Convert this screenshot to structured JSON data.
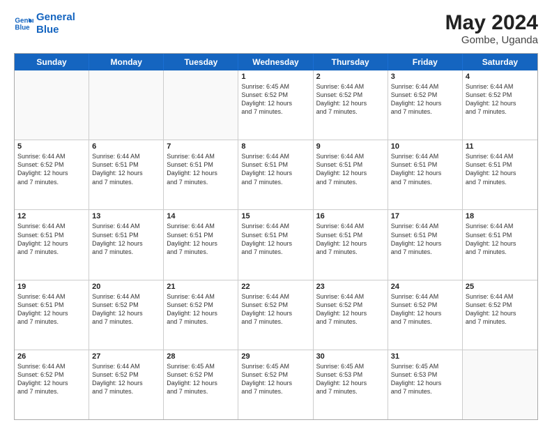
{
  "logo": {
    "line1": "General",
    "line2": "Blue"
  },
  "title": {
    "month_year": "May 2024",
    "location": "Gombe, Uganda"
  },
  "header_days": [
    "Sunday",
    "Monday",
    "Tuesday",
    "Wednesday",
    "Thursday",
    "Friday",
    "Saturday"
  ],
  "weeks": [
    [
      {
        "day": "",
        "info": ""
      },
      {
        "day": "",
        "info": ""
      },
      {
        "day": "",
        "info": ""
      },
      {
        "day": "1",
        "info": "Sunrise: 6:45 AM\nSunset: 6:52 PM\nDaylight: 12 hours\nand 7 minutes."
      },
      {
        "day": "2",
        "info": "Sunrise: 6:44 AM\nSunset: 6:52 PM\nDaylight: 12 hours\nand 7 minutes."
      },
      {
        "day": "3",
        "info": "Sunrise: 6:44 AM\nSunset: 6:52 PM\nDaylight: 12 hours\nand 7 minutes."
      },
      {
        "day": "4",
        "info": "Sunrise: 6:44 AM\nSunset: 6:52 PM\nDaylight: 12 hours\nand 7 minutes."
      }
    ],
    [
      {
        "day": "5",
        "info": "Sunrise: 6:44 AM\nSunset: 6:52 PM\nDaylight: 12 hours\nand 7 minutes."
      },
      {
        "day": "6",
        "info": "Sunrise: 6:44 AM\nSunset: 6:51 PM\nDaylight: 12 hours\nand 7 minutes."
      },
      {
        "day": "7",
        "info": "Sunrise: 6:44 AM\nSunset: 6:51 PM\nDaylight: 12 hours\nand 7 minutes."
      },
      {
        "day": "8",
        "info": "Sunrise: 6:44 AM\nSunset: 6:51 PM\nDaylight: 12 hours\nand 7 minutes."
      },
      {
        "day": "9",
        "info": "Sunrise: 6:44 AM\nSunset: 6:51 PM\nDaylight: 12 hours\nand 7 minutes."
      },
      {
        "day": "10",
        "info": "Sunrise: 6:44 AM\nSunset: 6:51 PM\nDaylight: 12 hours\nand 7 minutes."
      },
      {
        "day": "11",
        "info": "Sunrise: 6:44 AM\nSunset: 6:51 PM\nDaylight: 12 hours\nand 7 minutes."
      }
    ],
    [
      {
        "day": "12",
        "info": "Sunrise: 6:44 AM\nSunset: 6:51 PM\nDaylight: 12 hours\nand 7 minutes."
      },
      {
        "day": "13",
        "info": "Sunrise: 6:44 AM\nSunset: 6:51 PM\nDaylight: 12 hours\nand 7 minutes."
      },
      {
        "day": "14",
        "info": "Sunrise: 6:44 AM\nSunset: 6:51 PM\nDaylight: 12 hours\nand 7 minutes."
      },
      {
        "day": "15",
        "info": "Sunrise: 6:44 AM\nSunset: 6:51 PM\nDaylight: 12 hours\nand 7 minutes."
      },
      {
        "day": "16",
        "info": "Sunrise: 6:44 AM\nSunset: 6:51 PM\nDaylight: 12 hours\nand 7 minutes."
      },
      {
        "day": "17",
        "info": "Sunrise: 6:44 AM\nSunset: 6:51 PM\nDaylight: 12 hours\nand 7 minutes."
      },
      {
        "day": "18",
        "info": "Sunrise: 6:44 AM\nSunset: 6:51 PM\nDaylight: 12 hours\nand 7 minutes."
      }
    ],
    [
      {
        "day": "19",
        "info": "Sunrise: 6:44 AM\nSunset: 6:51 PM\nDaylight: 12 hours\nand 7 minutes."
      },
      {
        "day": "20",
        "info": "Sunrise: 6:44 AM\nSunset: 6:52 PM\nDaylight: 12 hours\nand 7 minutes."
      },
      {
        "day": "21",
        "info": "Sunrise: 6:44 AM\nSunset: 6:52 PM\nDaylight: 12 hours\nand 7 minutes."
      },
      {
        "day": "22",
        "info": "Sunrise: 6:44 AM\nSunset: 6:52 PM\nDaylight: 12 hours\nand 7 minutes."
      },
      {
        "day": "23",
        "info": "Sunrise: 6:44 AM\nSunset: 6:52 PM\nDaylight: 12 hours\nand 7 minutes."
      },
      {
        "day": "24",
        "info": "Sunrise: 6:44 AM\nSunset: 6:52 PM\nDaylight: 12 hours\nand 7 minutes."
      },
      {
        "day": "25",
        "info": "Sunrise: 6:44 AM\nSunset: 6:52 PM\nDaylight: 12 hours\nand 7 minutes."
      }
    ],
    [
      {
        "day": "26",
        "info": "Sunrise: 6:44 AM\nSunset: 6:52 PM\nDaylight: 12 hours\nand 7 minutes."
      },
      {
        "day": "27",
        "info": "Sunrise: 6:44 AM\nSunset: 6:52 PM\nDaylight: 12 hours\nand 7 minutes."
      },
      {
        "day": "28",
        "info": "Sunrise: 6:45 AM\nSunset: 6:52 PM\nDaylight: 12 hours\nand 7 minutes."
      },
      {
        "day": "29",
        "info": "Sunrise: 6:45 AM\nSunset: 6:52 PM\nDaylight: 12 hours\nand 7 minutes."
      },
      {
        "day": "30",
        "info": "Sunrise: 6:45 AM\nSunset: 6:53 PM\nDaylight: 12 hours\nand 7 minutes."
      },
      {
        "day": "31",
        "info": "Sunrise: 6:45 AM\nSunset: 6:53 PM\nDaylight: 12 hours\nand 7 minutes."
      },
      {
        "day": "",
        "info": ""
      }
    ]
  ]
}
